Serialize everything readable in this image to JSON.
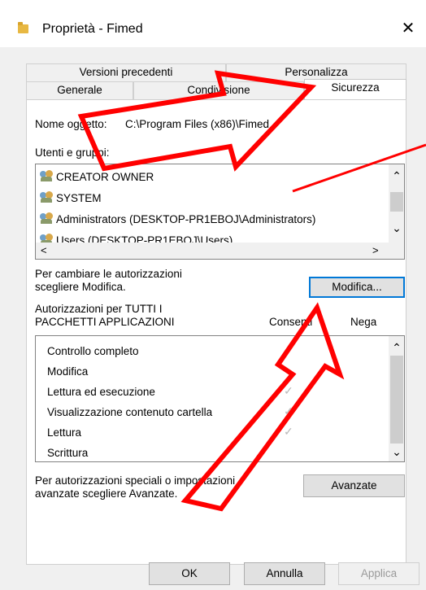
{
  "window": {
    "title": "Proprietà - Fimed",
    "close_glyph": "✕"
  },
  "tabs": {
    "row1": [
      "Versioni precedenti",
      "Personalizza"
    ],
    "row2": [
      "Generale",
      "Condivisione",
      "Sicurezza"
    ],
    "active": "Sicurezza"
  },
  "object_name": {
    "label": "Nome oggetto:",
    "value": "C:\\Program Files (x86)\\Fimed"
  },
  "users": {
    "label": "Utenti e gruppi:",
    "items": [
      "CREATOR OWNER",
      "SYSTEM",
      "Administrators (DESKTOP-PR1EBOJ\\Administrators)",
      "Users (DESKTOP-PR1EBOJ\\Users)"
    ]
  },
  "change_text": {
    "line1": "Per cambiare le autorizzazioni",
    "line2": "scegliere Modifica."
  },
  "modify_button": "Modifica...",
  "permissions": {
    "title1": "Autorizzazioni per TUTTI I",
    "title2": "PACCHETTI APPLICAZIONI",
    "col_allow": "Consenti",
    "col_deny": "Nega",
    "rows": [
      {
        "name": "Controllo completo",
        "allow": false
      },
      {
        "name": "Modifica",
        "allow": false
      },
      {
        "name": "Lettura ed esecuzione",
        "allow": true
      },
      {
        "name": "Visualizzazione contenuto cartella",
        "allow": true
      },
      {
        "name": "Lettura",
        "allow": true
      },
      {
        "name": "Scrittura",
        "allow": false
      }
    ]
  },
  "advanced_text": {
    "line1": "Per autorizzazioni speciali o impostazioni",
    "line2": "avanzate scegliere Avanzate."
  },
  "advanced_button": "Avanzate",
  "footer": {
    "ok": "OK",
    "cancel": "Annulla",
    "apply": "Applica"
  },
  "glyphs": {
    "up": "⌃",
    "down": "⌄",
    "left": "<",
    "right": ">",
    "check": "✓"
  },
  "colors": {
    "arrow": "#ff0000",
    "accent": "#0078d7",
    "panel_bg": "#ffffff",
    "dialog_bg": "#f0f0f0"
  }
}
